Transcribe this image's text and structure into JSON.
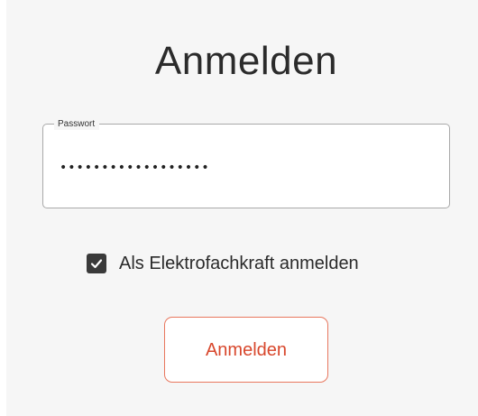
{
  "login": {
    "title": "Anmelden",
    "password": {
      "label": "Passwort",
      "value": "••••••••••••••••••"
    },
    "checkbox": {
      "label": "Als Elektrofachkraft anmelden",
      "checked": true
    },
    "submit_label": "Anmelden"
  },
  "colors": {
    "button_text": "#d8472c",
    "button_border": "#e8775e",
    "checkbox_fill": "#3a3a3a",
    "panel_background": "#f6f6f6"
  },
  "icons": {
    "checkbox": "checkmark-icon"
  }
}
